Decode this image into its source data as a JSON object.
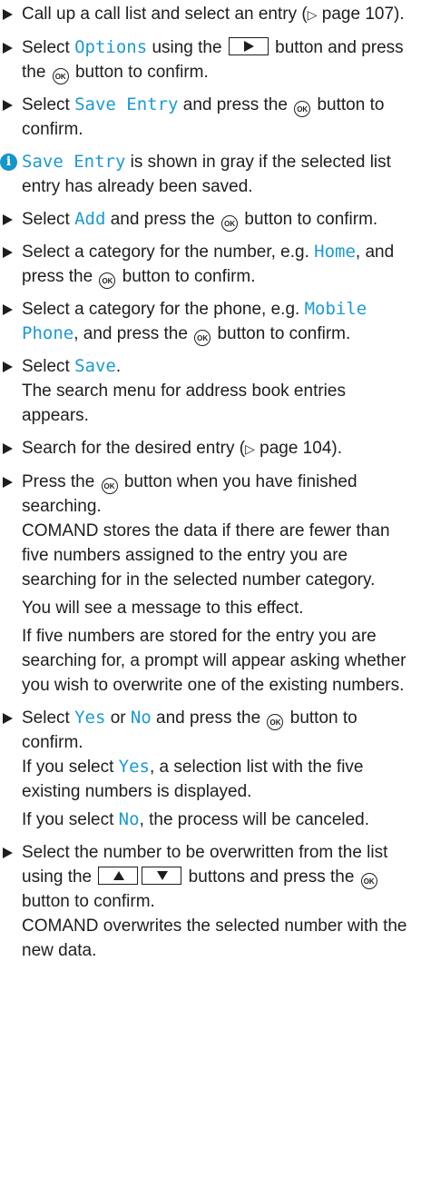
{
  "page": {
    "ok_key": "OK",
    "steps": [
      {
        "a": "Call up a call list and select an entry (",
        "b": " page 107)."
      },
      {
        "a": "Select ",
        "hl": "Options",
        "b": " using the ",
        "c": " button and press the ",
        "d": " button to confirm."
      },
      {
        "a": "Select ",
        "hl": "Save Entry",
        "b": " and press the ",
        "c": " button to confirm."
      },
      {
        "hl": "Save Entry",
        "b": " is shown in gray if the selected list entry has already been saved."
      },
      {
        "a": "Select ",
        "hl": "Add",
        "b": " and press the ",
        "c": " button to confirm."
      },
      {
        "a": "Select a category for the number, e.g. ",
        "hl": "Home",
        "b": ", and press the ",
        "c": " button to confirm."
      },
      {
        "a": "Select a category for the phone, e.g. ",
        "hl": "Mobile Phone",
        "b": ", and press the ",
        "c": " button to confirm."
      },
      {
        "a": "Select ",
        "hl": "Save",
        "b": ".",
        "c": "The search menu for address book entries appears."
      },
      {
        "a": "Search for the desired entry (",
        "b": " page 104)."
      },
      {
        "a": "Press the ",
        "b": " button when you have finished searching.",
        "c": "COMAND stores the data if there are fewer than five numbers assigned to the entry you are searching for in the selected number category.",
        "d": "You will see a message to this effect.",
        "e": "If five numbers are stored for the entry you are searching for, a prompt will appear asking whether you wish to overwrite one of the existing numbers."
      },
      {
        "a": "Select ",
        "hl1": "Yes",
        "b": " or ",
        "hl2": "No",
        "c": " and press the ",
        "d": " button to confirm.",
        "e": "If you select ",
        "hl3": "Yes",
        "f": ", a selection list with the five existing numbers is displayed.",
        "g": "If you select ",
        "hl4": "No",
        "h": ", the process will be canceled."
      },
      {
        "a": "Select the number to be overwritten from the list using the ",
        "b": " buttons and press the ",
        "c": " button to confirm.",
        "d": "COMAND overwrites the selected number with the new data."
      }
    ]
  }
}
